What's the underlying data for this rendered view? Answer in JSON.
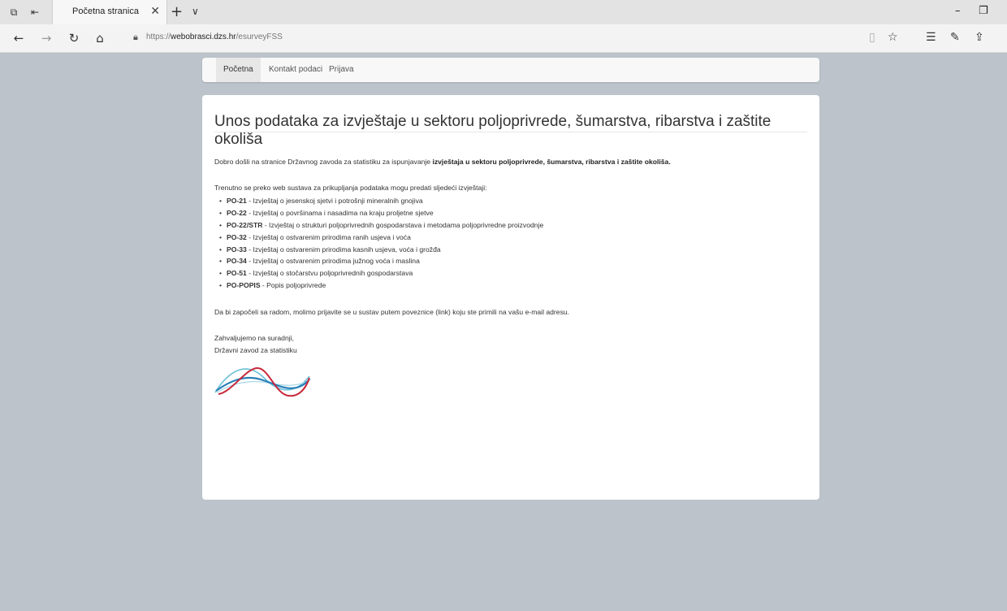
{
  "browser": {
    "tab_title": "Početna stranica",
    "url_prefix": "https://",
    "url_host": "webobrasci.dzs.hr",
    "url_path": "/esurveyFSS"
  },
  "nav": {
    "items": [
      "Početna",
      "Kontakt podaci",
      "Prijava"
    ],
    "active": "Početna"
  },
  "content": {
    "title": "Unos podataka za izvještaje u sektoru poljoprivrede, šumarstva, ribarstva i zaštite okoliša",
    "welcome_prefix": "Dobro došli na stranice Državnog zavoda za statistiku za ispunjavanje ",
    "welcome_bold": "izvještaja u sektoru poljoprivrede, šumarstva, ribarstva i zaštite okoliša.",
    "intro": "Trenutno se preko web sustava za prikupljanja podataka mogu predati sljedeći izvještaji:",
    "forms": [
      {
        "code": "PO-21",
        "desc": " - Izvještaj o jesenskoj sjetvi i potrošnji mineralnih gnojiva"
      },
      {
        "code": "PO-22",
        "desc": " - Izvještaj o površinama i nasadima na kraju proljetne sjetve"
      },
      {
        "code": "PO-22/STR",
        "desc": " - Izvještaj o strukturi poljoprivrednih gospodarstava i metodama poljoprivredne proizvodnje"
      },
      {
        "code": "PO-32",
        "desc": " - Izvještaj o ostvarenim prirodima ranih usjeva i voća"
      },
      {
        "code": "PO-33",
        "desc": " - Izvještaj o ostvarenim prirodima kasnih usjeva, voća i grožđa"
      },
      {
        "code": "PO-34",
        "desc": " - Izvještaj o ostvarenim prirodima južnog voća i maslina"
      },
      {
        "code": "PO-51",
        "desc": " - Izvještaj o stočarstvu poljoprivrednih gospodarstava"
      },
      {
        "code": "PO-POPIS",
        "desc": " - Popis poljoprivrede"
      }
    ],
    "login_note": "Da bi započeli sa radom, molimo prijavite se u sustav putem poveznice (link) koju ste primili na vašu e-mail adresu.",
    "thanks": "Zahvaljujemo na suradnji,",
    "signature": "Državni zavod za statistiku"
  },
  "colors": {
    "page_bg": "#bcc3ca",
    "logo_red": "#c8283a",
    "logo_blue": "#2a7fb8",
    "logo_teal": "#6bc0d8"
  },
  "icons": [
    "tab-actions-icon",
    "tab-set-aside-icon",
    "close-tab-icon",
    "new-tab-icon",
    "tab-list-chevron-icon",
    "minimize-icon",
    "restore-icon",
    "back-icon",
    "forward-icon",
    "refresh-icon",
    "home-icon",
    "lock-icon",
    "reading-view-icon",
    "favorite-star-icon",
    "favorites-list-icon",
    "pen-icon",
    "share-icon"
  ]
}
